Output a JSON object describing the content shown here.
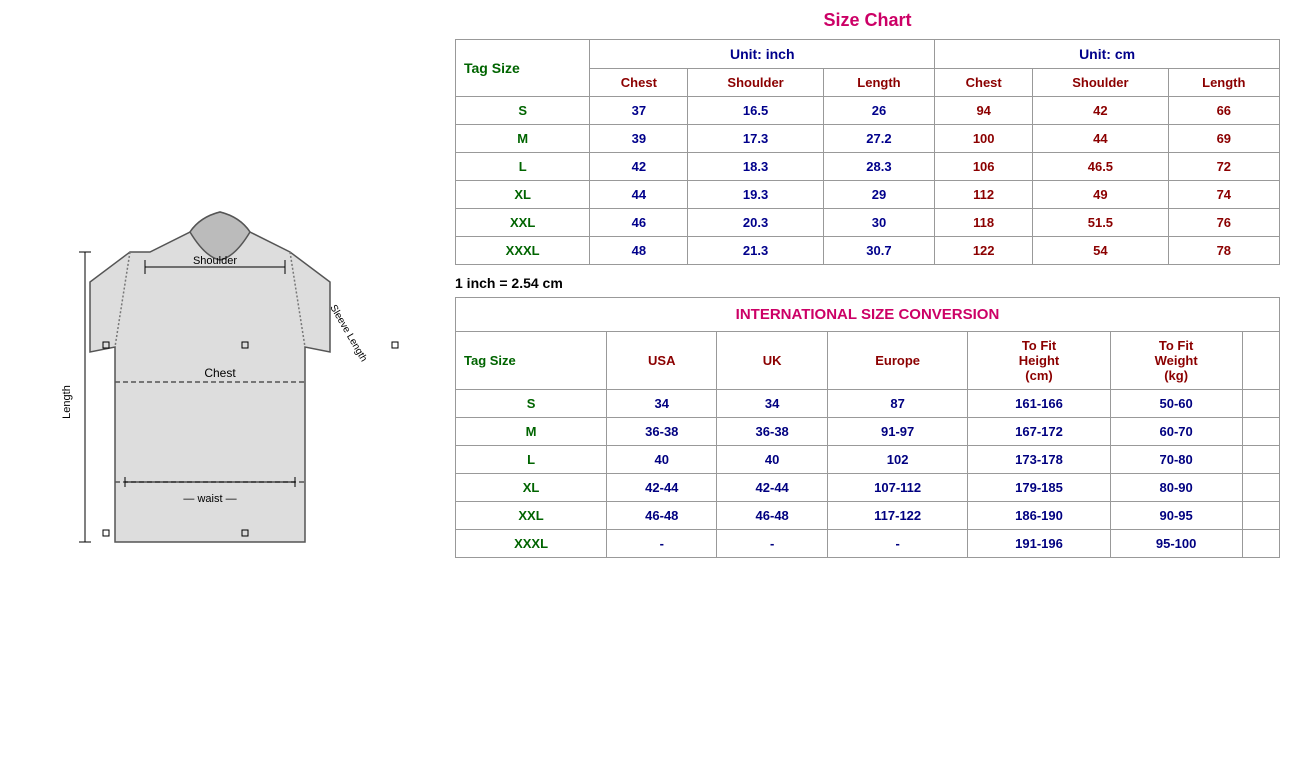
{
  "sizeChart": {
    "title": "Size Chart",
    "unitInch": "Unit: inch",
    "unitCm": "Unit: cm",
    "tagSizeLabel": "Tag Size",
    "columns": {
      "inch": [
        "Chest",
        "Shoulder",
        "Length"
      ],
      "cm": [
        "Chest",
        "Shoulder",
        "Length"
      ]
    },
    "rows": [
      {
        "tag": "S",
        "chest_in": "37",
        "shoulder_in": "16.5",
        "length_in": "26",
        "chest_cm": "94",
        "shoulder_cm": "42",
        "length_cm": "66"
      },
      {
        "tag": "M",
        "chest_in": "39",
        "shoulder_in": "17.3",
        "length_in": "27.2",
        "chest_cm": "100",
        "shoulder_cm": "44",
        "length_cm": "69"
      },
      {
        "tag": "L",
        "chest_in": "42",
        "shoulder_in": "18.3",
        "length_in": "28.3",
        "chest_cm": "106",
        "shoulder_cm": "46.5",
        "length_cm": "72"
      },
      {
        "tag": "XL",
        "chest_in": "44",
        "shoulder_in": "19.3",
        "length_in": "29",
        "chest_cm": "112",
        "shoulder_cm": "49",
        "length_cm": "74"
      },
      {
        "tag": "XXL",
        "chest_in": "46",
        "shoulder_in": "20.3",
        "length_in": "30",
        "chest_cm": "118",
        "shoulder_cm": "51.5",
        "length_cm": "76"
      },
      {
        "tag": "XXXL",
        "chest_in": "48",
        "shoulder_in": "21.3",
        "length_in": "30.7",
        "chest_cm": "122",
        "shoulder_cm": "54",
        "length_cm": "78"
      }
    ],
    "conversionNote": "1 inch = 2.54 cm"
  },
  "conversion": {
    "title": "INTERNATIONAL SIZE CONVERSION",
    "tagSizeLabel": "Tag Size",
    "columns": [
      "USA",
      "UK",
      "Europe",
      "To Fit\nHeight\n(cm)",
      "To Fit\nWeight\n(kg)"
    ],
    "colHeaders": {
      "usa": "USA",
      "uk": "UK",
      "europe": "Europe",
      "height_label1": "To Fit",
      "height_label2": "Height",
      "height_label3": "(cm)",
      "weight_label1": "To Fit",
      "weight_label2": "Weight",
      "weight_label3": "(kg)"
    },
    "rows": [
      {
        "tag": "S",
        "usa": "34",
        "uk": "34",
        "europe": "87",
        "height": "161-166",
        "weight": "50-60"
      },
      {
        "tag": "M",
        "usa": "36-38",
        "uk": "36-38",
        "europe": "91-97",
        "height": "167-172",
        "weight": "60-70"
      },
      {
        "tag": "L",
        "usa": "40",
        "uk": "40",
        "europe": "102",
        "height": "173-178",
        "weight": "70-80"
      },
      {
        "tag": "XL",
        "usa": "42-44",
        "uk": "42-44",
        "europe": "107-112",
        "height": "179-185",
        "weight": "80-90"
      },
      {
        "tag": "XXL",
        "usa": "46-48",
        "uk": "46-48",
        "europe": "117-122",
        "height": "186-190",
        "weight": "90-95"
      },
      {
        "tag": "XXXL",
        "usa": "-",
        "uk": "-",
        "europe": "-",
        "height": "191-196",
        "weight": "95-100"
      }
    ]
  },
  "diagram": {
    "labels": {
      "shoulder": "Shoulder",
      "sleeveLength": "Sleeve Length",
      "chest": "Chest",
      "length": "Length",
      "waist": "waist"
    }
  }
}
